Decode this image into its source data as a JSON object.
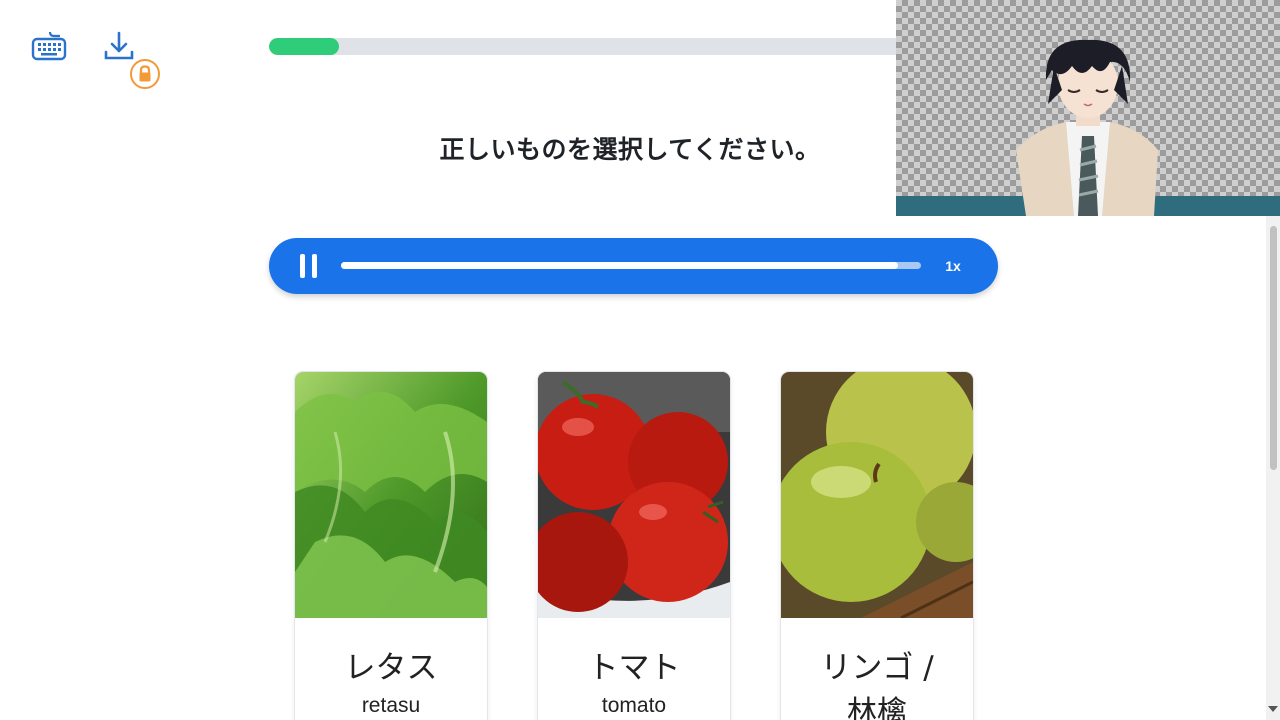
{
  "toolbar": {
    "keyboard_icon": "keyboard-icon",
    "download_icon": "download-icon",
    "lock_icon": "lock-icon"
  },
  "progress": {
    "value_fraction": 0.11,
    "color": "#2fcc7a"
  },
  "question": {
    "text": "正しいものを選択してください。"
  },
  "audio_player": {
    "state": "playing",
    "pause_icon": "pause-icon",
    "played_fraction": 0.96,
    "speed_label": "1x",
    "color": "#1a73e8"
  },
  "choices": [
    {
      "label": "レタス",
      "romaji": "retasu",
      "image": "lettuce"
    },
    {
      "label": "トマト",
      "romaji": "tomato",
      "image": "tomatoes"
    },
    {
      "label": "リンゴ /",
      "label_line2": "林檎",
      "image": "green-apples"
    }
  ],
  "webcam": {
    "content": "vtuber-avatar"
  }
}
